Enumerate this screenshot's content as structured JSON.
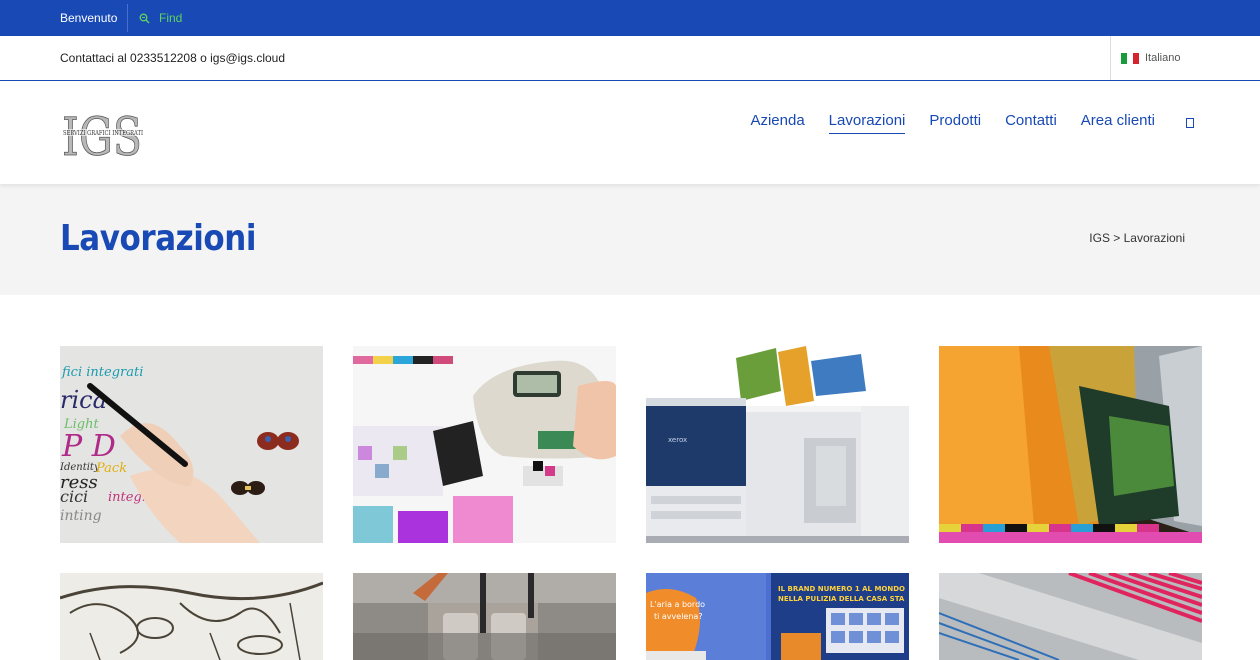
{
  "topbar": {
    "welcome": "Benvenuto",
    "find": "Find"
  },
  "contactbar": {
    "contact": "Contattaci al 0233512208 o igs@igs.cloud",
    "language": "Italiano"
  },
  "logo": {
    "letters": "IGS",
    "tagline": "SERVIZI GRAFICI INTEGRATI"
  },
  "nav": {
    "items": [
      {
        "label": "Azienda"
      },
      {
        "label": "Lavorazioni"
      },
      {
        "label": "Prodotti"
      },
      {
        "label": "Contatti"
      },
      {
        "label": "Area clienti"
      }
    ],
    "active_index": 1
  },
  "page": {
    "title": "Lavorazioni",
    "breadcrumb": "IGS > Lavorazioni"
  },
  "gallery": {
    "tiles": [
      {
        "icon": "hand-writing-butterflies-image"
      },
      {
        "icon": "spectrophotometer-color-chart-image"
      },
      {
        "icon": "xerox-digital-press-image"
      },
      {
        "icon": "offset-printing-roll-image"
      },
      {
        "icon": "engraved-botanical-print-image"
      },
      {
        "icon": "sewing-machine-foot-image"
      },
      {
        "icon": "promotional-posters-image"
      },
      {
        "icon": "color-bar-stripes-image"
      }
    ]
  },
  "colors": {
    "brand_blue": "#1849b5",
    "find_green": "#5fd35f",
    "strip_bg": "#f4f4f4"
  }
}
